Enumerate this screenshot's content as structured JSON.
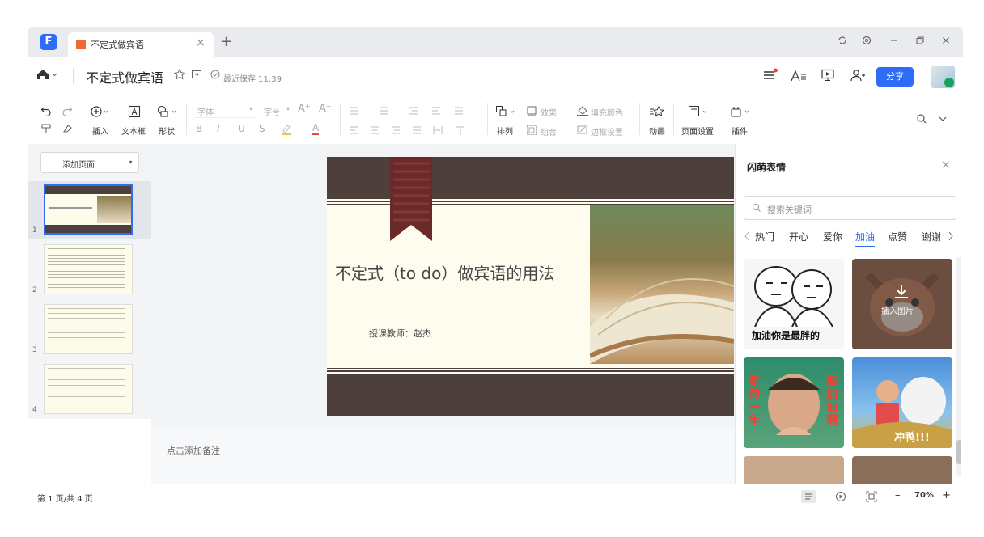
{
  "titlebar": {
    "logo_text": "F",
    "tab_title": "不定式做宾语",
    "tab_close": "×",
    "new_tab": "+"
  },
  "header": {
    "doc_title": "不定式做宾语",
    "save_status": "最近保存 11:39",
    "share_label": "分享"
  },
  "toolbar": {
    "insert": "插入",
    "textbox": "文本框",
    "shape": "形状",
    "font_placeholder": "字体",
    "size_placeholder": "字号",
    "arrange": "排列",
    "group": "组合",
    "effect": "效果",
    "fill_color": "填充颜色",
    "border_settings": "边框设置",
    "animation": "动画",
    "page_setup": "页面设置",
    "plugins": "插件",
    "format_letters": [
      "B",
      "I",
      "U",
      "S",
      "A"
    ]
  },
  "left_panel": {
    "add_page_label": "添加页面",
    "thumbnails": [
      {
        "num": "1"
      },
      {
        "num": "2"
      },
      {
        "num": "3"
      },
      {
        "num": "4"
      }
    ]
  },
  "slide": {
    "title": "不定式（to do）做宾语的用法",
    "teacher": "授课教师：赵杰"
  },
  "notes": {
    "placeholder": "点击添加备注"
  },
  "right_panel": {
    "title": "闪萌表情",
    "search_placeholder": "搜索关键词",
    "categories": [
      "热门",
      "开心",
      "爱你",
      "加油",
      "点赞",
      "谢谢"
    ],
    "active_category": "加油",
    "sticker1_caption": "加油你是最胖的",
    "insert_label": "插入图片",
    "sticker3_text_left": "新的一年",
    "sticker3_text_right": "要加油啊",
    "sticker4_caption": "冲鸭!!!"
  },
  "status": {
    "page_indicator": "第 1 页/共 4 页",
    "zoom": "70%",
    "zoom_minus": "–",
    "zoom_plus": "+"
  },
  "colors": {
    "accent": "#2f6cf6",
    "slide_band": "#4d403c",
    "slide_bg": "#fdfcee",
    "ribbon": "#6b2a2a"
  }
}
